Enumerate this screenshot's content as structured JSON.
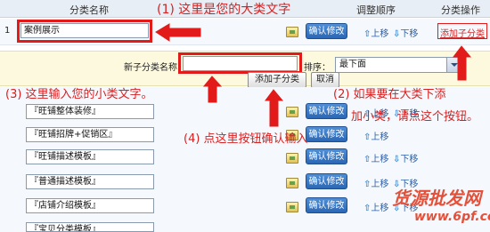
{
  "header": {
    "col_name": "分类名称",
    "col_order": "调整顺序",
    "col_action": "分类操作"
  },
  "top_row": {
    "index": "1",
    "name_value": "案例展示",
    "confirm_label": "确认修改",
    "up_label": "上移",
    "down_label": "下移",
    "add_sub_label": "添加子分类"
  },
  "sub_form": {
    "name_label": "新子分类名称",
    "name_value": "",
    "order_label": "排序：",
    "order_value": "最下面",
    "add_button": "添加子分类",
    "cancel_button": "取消"
  },
  "sub_rows": [
    {
      "name": "『旺铺整体装修』",
      "confirm": "确认修改",
      "up": "上移",
      "down": "下移"
    },
    {
      "name": "『旺铺招牌+促销区』",
      "confirm": "确认修改",
      "up": "上移",
      "down": "下移"
    },
    {
      "name": "『旺铺描述模板』",
      "confirm": "确认修改",
      "up": "上移",
      "down": "下移"
    },
    {
      "name": "『普通描述模板』",
      "confirm": "确认修改",
      "up": "上移",
      "down": "下移"
    },
    {
      "name": "『店铺介绍模板』",
      "confirm": "确认修改",
      "up": "上移",
      "down": "下移"
    },
    {
      "name": "『宝贝分类模板』",
      "confirm": "",
      "up": "",
      "down": ""
    }
  ],
  "annotations": {
    "a1": "(1) 这里是您的大类文字",
    "a2_line1": "(2) 如果要在大类下添",
    "a2_line2": "加小类，请点这个按钮。",
    "a3": "(3) 这里输入您的小类文字。",
    "a4": "(4) 点这里按钮确认输入"
  },
  "watermark": {
    "text1": "货源批发网",
    "text2": "www.6pf.com"
  },
  "colors": {
    "annotation_red": "#e21a1a",
    "confirm_blue": "#2b67b5",
    "link_blue": "#2d5fa8"
  }
}
